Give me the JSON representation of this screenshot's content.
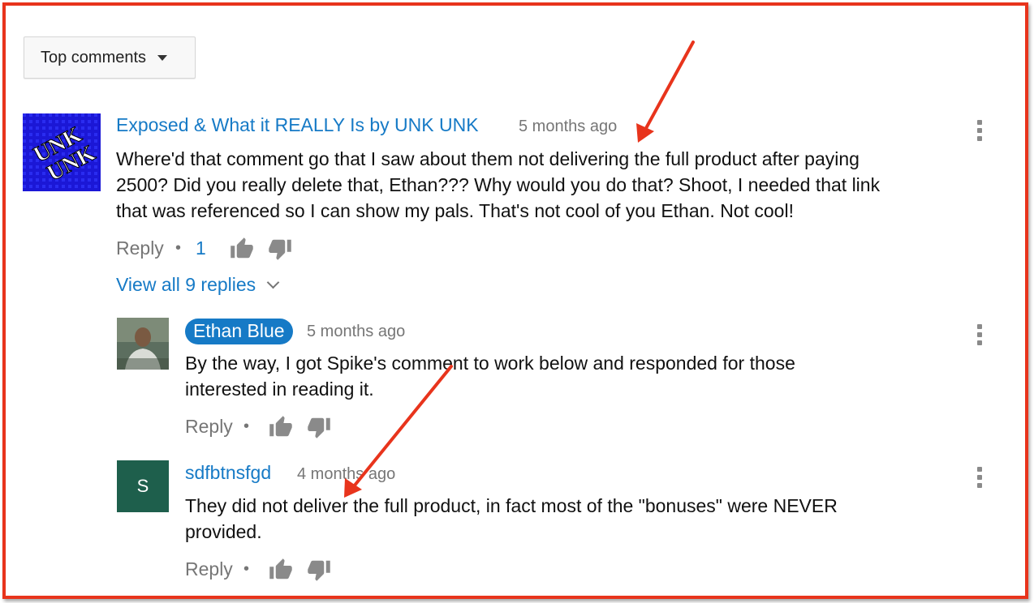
{
  "sort": {
    "label": "Top comments"
  },
  "comments": [
    {
      "author": "Exposed & What it REALLY Is by UNK UNK",
      "time": "5 months ago",
      "text_lines": [
        "Where'd that comment go that I saw about them not delivering the full product after paying",
        "2500? Did you really delete that, Ethan??? Why would you do that? Shoot, I needed that link",
        "that was referenced so I can show my pals. That's not cool of you Ethan. Not cool!"
      ],
      "avatar_text": [
        "UNK",
        "UNK"
      ],
      "reply_label": "Reply",
      "separator": "•",
      "likes": "1",
      "view_replies": "View all 9 replies"
    }
  ],
  "replies": [
    {
      "author": "Ethan Blue",
      "time": "5 months ago",
      "text_lines": [
        "By the way, I got Spike's comment to work below and responded for those",
        "interested in reading it."
      ],
      "reply_label": "Reply",
      "separator": "•"
    },
    {
      "author": "sdfbtnsfgd",
      "time": "4 months ago",
      "avatar_letter": "S",
      "text_lines": [
        "They did not deliver the full product, in fact most of the \"bonuses\" were NEVER",
        "provided."
      ],
      "reply_label": "Reply",
      "separator": "•"
    }
  ],
  "colors": {
    "link_blue": "#167ac6",
    "annotation_red": "#e8341c",
    "meta_gray": "#767676",
    "avatar_green": "#1e5f4c"
  },
  "icons": [
    "caret-down-icon",
    "thumbs-up-icon",
    "thumbs-down-icon",
    "more-vert-icon",
    "chevron-down-icon"
  ]
}
